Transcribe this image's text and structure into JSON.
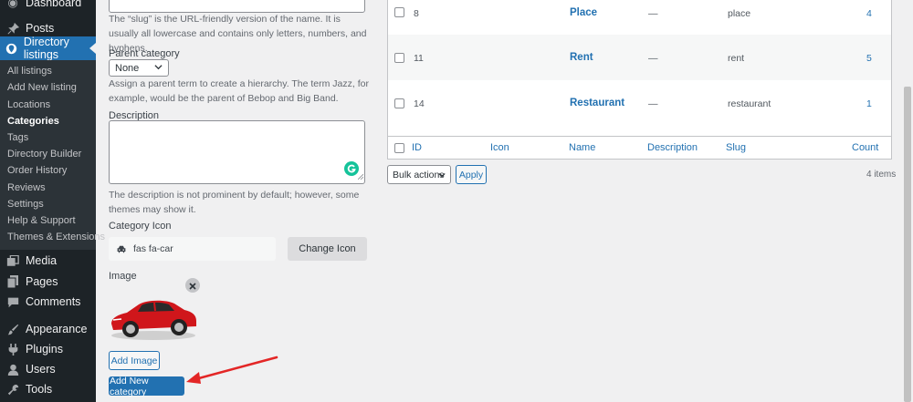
{
  "sidebar": {
    "dashboard": "Dashboard",
    "posts": "Posts",
    "directory_listings": "Directory listings",
    "submenu": [
      "All listings",
      "Add New listing",
      "Locations",
      "Categories",
      "Tags",
      "Directory Builder",
      "Order History",
      "Reviews",
      "Settings",
      "Help & Support",
      "Themes & Extensions"
    ],
    "media": "Media",
    "pages": "Pages",
    "comments": "Comments",
    "appearance": "Appearance",
    "plugins": "Plugins",
    "users": "Users",
    "tools": "Tools"
  },
  "form": {
    "slug_desc": "The “slug” is the URL-friendly version of the name. It is usually all lowercase and contains only letters, numbers, and hyphens.",
    "parent_label": "Parent category",
    "parent_value": "None",
    "parent_desc": "Assign a parent term to create a hierarchy. The term Jazz, for example, would be the parent of Bebop and Big Band.",
    "description_label": "Description",
    "description_desc": "The description is not prominent by default; however, some themes may show it.",
    "icon_label": "Category Icon",
    "icon_value": "fas fa-car",
    "change_icon": "Change Icon",
    "image_label": "Image",
    "add_image": "Add Image",
    "submit": "Add New category"
  },
  "table": {
    "rows": [
      {
        "id": "8",
        "name": "Place",
        "description": "—",
        "slug": "place",
        "count": "4"
      },
      {
        "id": "11",
        "name": "Rent",
        "description": "—",
        "slug": "rent",
        "count": "5"
      },
      {
        "id": "14",
        "name": "Restaurant",
        "description": "—",
        "slug": "restaurant",
        "count": "1"
      }
    ],
    "columns": {
      "id": "ID",
      "icon": "Icon",
      "name": "Name",
      "description": "Description",
      "slug": "Slug",
      "count": "Count"
    },
    "bulk_actions": "Bulk actions",
    "apply": "Apply",
    "items_count": "4 items"
  },
  "colors": {
    "accent": "#2271b1",
    "sidebar_bg": "#1d2327",
    "arrow": "#e32626",
    "car": "#d0161b"
  }
}
